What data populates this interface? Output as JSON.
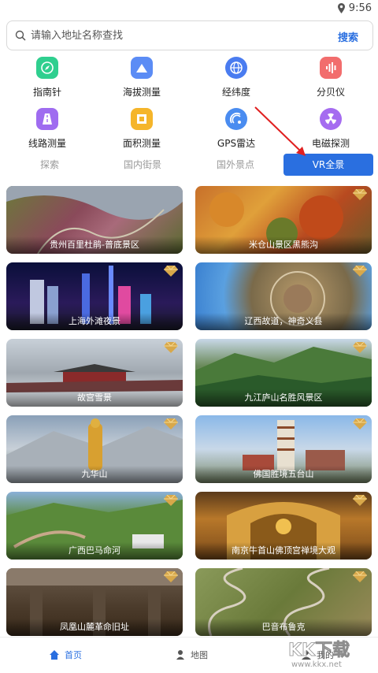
{
  "status": {
    "time": "9:56"
  },
  "search": {
    "placeholder": "请输入地址名称查找",
    "button": "搜索"
  },
  "tools": [
    {
      "label": "指南针",
      "icon": "compass-icon",
      "color": "#2fcf8f"
    },
    {
      "label": "海拔测量",
      "icon": "mountain-icon",
      "color": "#5b8cf5"
    },
    {
      "label": "经纬度",
      "icon": "globe-icon",
      "color": "#4a7cf0"
    },
    {
      "label": "分贝仪",
      "icon": "soundwave-icon",
      "color": "#f26d6d"
    },
    {
      "label": "线路测量",
      "icon": "road-icon",
      "color": "#9f6cf0"
    },
    {
      "label": "面积测量",
      "icon": "area-icon",
      "color": "#f5b52a"
    },
    {
      "label": "GPS雷达",
      "icon": "radar-icon",
      "color": "#4a8cf0"
    },
    {
      "label": "电磁探测",
      "icon": "radiation-icon",
      "color": "#a56cf0"
    }
  ],
  "tabs": [
    "探索",
    "国内街景",
    "国外景点",
    "VR全景"
  ],
  "active_tab": "VR全景",
  "cards": [
    {
      "title": "贵州百里杜鹃-普底景区",
      "gem": false
    },
    {
      "title": "米仓山景区黑熊沟",
      "gem": true
    },
    {
      "title": "上海外滩夜景",
      "gem": true
    },
    {
      "title": "辽西故道，神奇义县",
      "gem": true
    },
    {
      "title": "故宫雪景",
      "gem": true
    },
    {
      "title": "九江庐山名胜风景区",
      "gem": true
    },
    {
      "title": "九华山",
      "gem": true
    },
    {
      "title": "佛国胜境五台山",
      "gem": true
    },
    {
      "title": "广西巴马命河",
      "gem": true
    },
    {
      "title": "南京牛首山佛顶宫禅境大观",
      "gem": true
    },
    {
      "title": "凤凰山麓革命旧址",
      "gem": true
    },
    {
      "title": "巴音布鲁克",
      "gem": true
    }
  ],
  "nav": {
    "home": "首页",
    "map": "地图",
    "mine": "我的"
  },
  "watermark": {
    "brand": "KK下载",
    "url": "www.kkx.net"
  }
}
